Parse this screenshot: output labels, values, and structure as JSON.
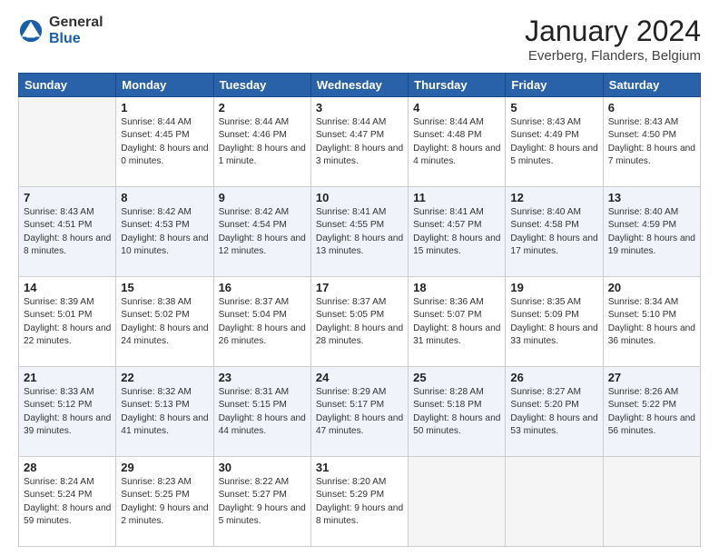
{
  "logo": {
    "general": "General",
    "blue": "Blue"
  },
  "header": {
    "title": "January 2024",
    "location": "Everberg, Flanders, Belgium"
  },
  "weekdays": [
    "Sunday",
    "Monday",
    "Tuesday",
    "Wednesday",
    "Thursday",
    "Friday",
    "Saturday"
  ],
  "weeks": [
    [
      {
        "day": "",
        "sunrise": "",
        "sunset": "",
        "daylight": ""
      },
      {
        "day": "1",
        "sunrise": "Sunrise: 8:44 AM",
        "sunset": "Sunset: 4:45 PM",
        "daylight": "Daylight: 8 hours and 0 minutes."
      },
      {
        "day": "2",
        "sunrise": "Sunrise: 8:44 AM",
        "sunset": "Sunset: 4:46 PM",
        "daylight": "Daylight: 8 hours and 1 minute."
      },
      {
        "day": "3",
        "sunrise": "Sunrise: 8:44 AM",
        "sunset": "Sunset: 4:47 PM",
        "daylight": "Daylight: 8 hours and 3 minutes."
      },
      {
        "day": "4",
        "sunrise": "Sunrise: 8:44 AM",
        "sunset": "Sunset: 4:48 PM",
        "daylight": "Daylight: 8 hours and 4 minutes."
      },
      {
        "day": "5",
        "sunrise": "Sunrise: 8:43 AM",
        "sunset": "Sunset: 4:49 PM",
        "daylight": "Daylight: 8 hours and 5 minutes."
      },
      {
        "day": "6",
        "sunrise": "Sunrise: 8:43 AM",
        "sunset": "Sunset: 4:50 PM",
        "daylight": "Daylight: 8 hours and 7 minutes."
      }
    ],
    [
      {
        "day": "7",
        "sunrise": "Sunrise: 8:43 AM",
        "sunset": "Sunset: 4:51 PM",
        "daylight": "Daylight: 8 hours and 8 minutes."
      },
      {
        "day": "8",
        "sunrise": "Sunrise: 8:42 AM",
        "sunset": "Sunset: 4:53 PM",
        "daylight": "Daylight: 8 hours and 10 minutes."
      },
      {
        "day": "9",
        "sunrise": "Sunrise: 8:42 AM",
        "sunset": "Sunset: 4:54 PM",
        "daylight": "Daylight: 8 hours and 12 minutes."
      },
      {
        "day": "10",
        "sunrise": "Sunrise: 8:41 AM",
        "sunset": "Sunset: 4:55 PM",
        "daylight": "Daylight: 8 hours and 13 minutes."
      },
      {
        "day": "11",
        "sunrise": "Sunrise: 8:41 AM",
        "sunset": "Sunset: 4:57 PM",
        "daylight": "Daylight: 8 hours and 15 minutes."
      },
      {
        "day": "12",
        "sunrise": "Sunrise: 8:40 AM",
        "sunset": "Sunset: 4:58 PM",
        "daylight": "Daylight: 8 hours and 17 minutes."
      },
      {
        "day": "13",
        "sunrise": "Sunrise: 8:40 AM",
        "sunset": "Sunset: 4:59 PM",
        "daylight": "Daylight: 8 hours and 19 minutes."
      }
    ],
    [
      {
        "day": "14",
        "sunrise": "Sunrise: 8:39 AM",
        "sunset": "Sunset: 5:01 PM",
        "daylight": "Daylight: 8 hours and 22 minutes."
      },
      {
        "day": "15",
        "sunrise": "Sunrise: 8:38 AM",
        "sunset": "Sunset: 5:02 PM",
        "daylight": "Daylight: 8 hours and 24 minutes."
      },
      {
        "day": "16",
        "sunrise": "Sunrise: 8:37 AM",
        "sunset": "Sunset: 5:04 PM",
        "daylight": "Daylight: 8 hours and 26 minutes."
      },
      {
        "day": "17",
        "sunrise": "Sunrise: 8:37 AM",
        "sunset": "Sunset: 5:05 PM",
        "daylight": "Daylight: 8 hours and 28 minutes."
      },
      {
        "day": "18",
        "sunrise": "Sunrise: 8:36 AM",
        "sunset": "Sunset: 5:07 PM",
        "daylight": "Daylight: 8 hours and 31 minutes."
      },
      {
        "day": "19",
        "sunrise": "Sunrise: 8:35 AM",
        "sunset": "Sunset: 5:09 PM",
        "daylight": "Daylight: 8 hours and 33 minutes."
      },
      {
        "day": "20",
        "sunrise": "Sunrise: 8:34 AM",
        "sunset": "Sunset: 5:10 PM",
        "daylight": "Daylight: 8 hours and 36 minutes."
      }
    ],
    [
      {
        "day": "21",
        "sunrise": "Sunrise: 8:33 AM",
        "sunset": "Sunset: 5:12 PM",
        "daylight": "Daylight: 8 hours and 39 minutes."
      },
      {
        "day": "22",
        "sunrise": "Sunrise: 8:32 AM",
        "sunset": "Sunset: 5:13 PM",
        "daylight": "Daylight: 8 hours and 41 minutes."
      },
      {
        "day": "23",
        "sunrise": "Sunrise: 8:31 AM",
        "sunset": "Sunset: 5:15 PM",
        "daylight": "Daylight: 8 hours and 44 minutes."
      },
      {
        "day": "24",
        "sunrise": "Sunrise: 8:29 AM",
        "sunset": "Sunset: 5:17 PM",
        "daylight": "Daylight: 8 hours and 47 minutes."
      },
      {
        "day": "25",
        "sunrise": "Sunrise: 8:28 AM",
        "sunset": "Sunset: 5:18 PM",
        "daylight": "Daylight: 8 hours and 50 minutes."
      },
      {
        "day": "26",
        "sunrise": "Sunrise: 8:27 AM",
        "sunset": "Sunset: 5:20 PM",
        "daylight": "Daylight: 8 hours and 53 minutes."
      },
      {
        "day": "27",
        "sunrise": "Sunrise: 8:26 AM",
        "sunset": "Sunset: 5:22 PM",
        "daylight": "Daylight: 8 hours and 56 minutes."
      }
    ],
    [
      {
        "day": "28",
        "sunrise": "Sunrise: 8:24 AM",
        "sunset": "Sunset: 5:24 PM",
        "daylight": "Daylight: 8 hours and 59 minutes."
      },
      {
        "day": "29",
        "sunrise": "Sunrise: 8:23 AM",
        "sunset": "Sunset: 5:25 PM",
        "daylight": "Daylight: 9 hours and 2 minutes."
      },
      {
        "day": "30",
        "sunrise": "Sunrise: 8:22 AM",
        "sunset": "Sunset: 5:27 PM",
        "daylight": "Daylight: 9 hours and 5 minutes."
      },
      {
        "day": "31",
        "sunrise": "Sunrise: 8:20 AM",
        "sunset": "Sunset: 5:29 PM",
        "daylight": "Daylight: 9 hours and 8 minutes."
      },
      {
        "day": "",
        "sunrise": "",
        "sunset": "",
        "daylight": ""
      },
      {
        "day": "",
        "sunrise": "",
        "sunset": "",
        "daylight": ""
      },
      {
        "day": "",
        "sunrise": "",
        "sunset": "",
        "daylight": ""
      }
    ]
  ]
}
